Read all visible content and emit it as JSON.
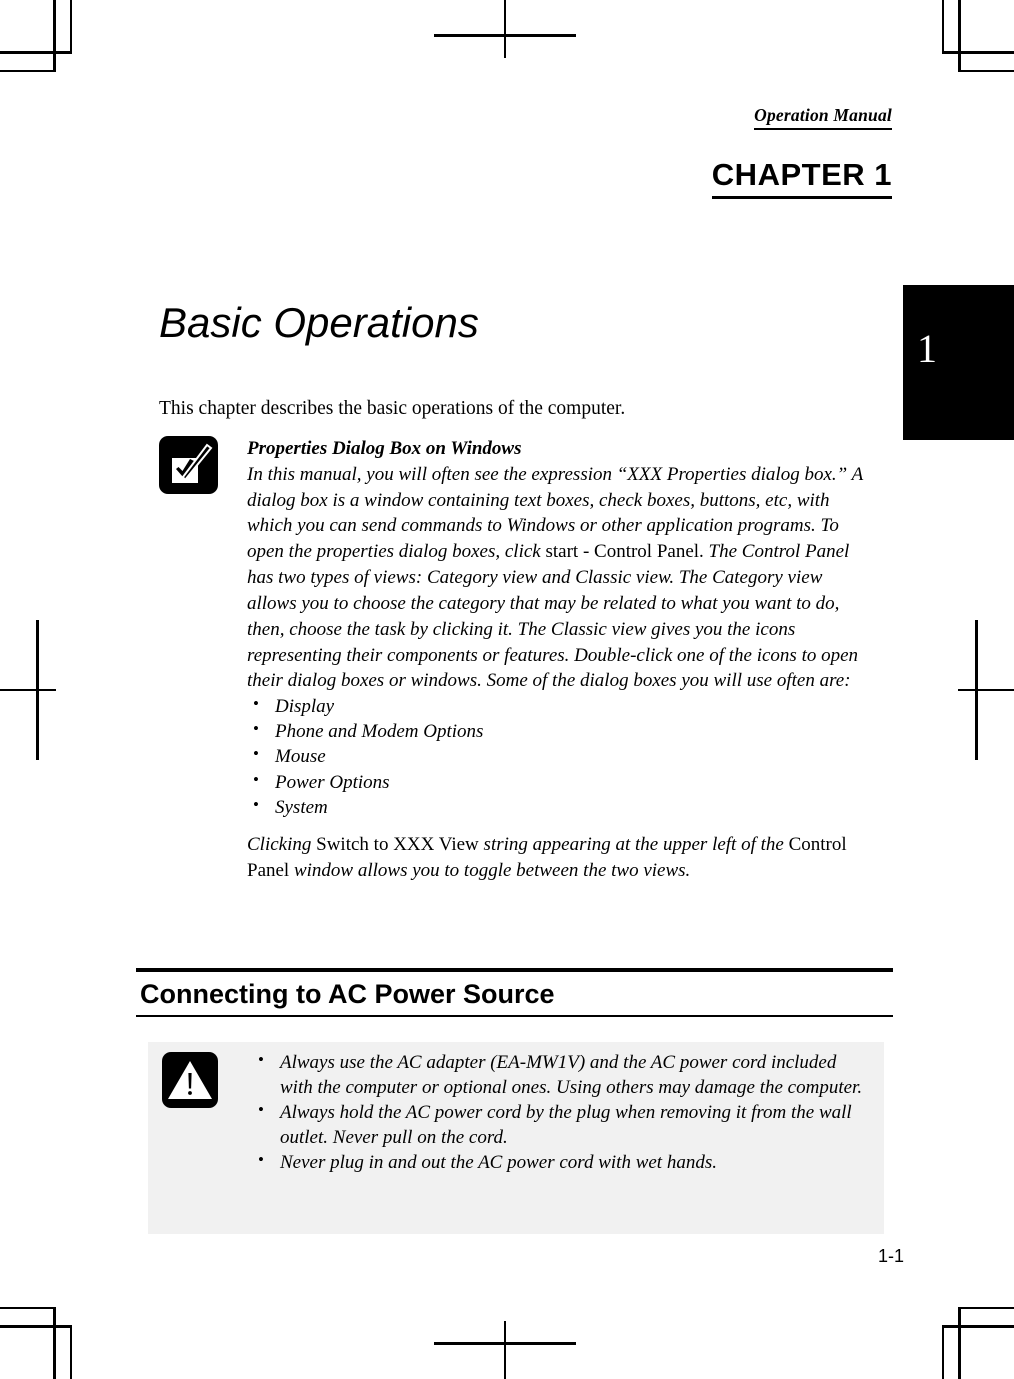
{
  "header": {
    "running_head": "Operation Manual",
    "chapter_label": "CHAPTER 1",
    "chapter_tab_number": "1"
  },
  "title": "Basic Operations",
  "intro_paragraph": "This chapter describes the basic operations of the computer.",
  "note": {
    "icon": "checkmark-note-icon",
    "heading": "Properties Dialog Box on Windows",
    "paragraph_part1": "In this manual, you will often see the expression “XXX Properties dialog box.” A dialog box is a window containing text boxes, check boxes, buttons, etc, with which you can send commands to Windows or other application programs. To open the properties dialog boxes, click ",
    "paragraph_roman1": "start - Control Panel.",
    "paragraph_part2": " The Control Panel has two types of views: Category view and Classic view. The Category view allows you to choose the category that may be related to what you want to do, then, choose the task by clicking it.  The Classic view gives you the icons representing their components or features. Double-click one of the icons to open their dialog boxes or windows.  Some of the dialog boxes you will use often are:",
    "list": [
      "Display",
      "Phone and Modem Options",
      "Mouse",
      "Power Options",
      "System"
    ],
    "closing_italic1": "Clicking ",
    "closing_roman1": "Switch to XXX View",
    "closing_italic2": " string appearing at the upper left of the ",
    "closing_roman2": "Control Panel",
    "closing_italic3": " window allows you to toggle between the two views."
  },
  "section": {
    "heading": "Connecting to AC Power Source"
  },
  "warning": {
    "icon": "warning-triangle-icon",
    "background_color": "#f1f1f1",
    "items": [
      "Always use the AC adapter (EA-MW1V) and the AC power cord included with the computer or optional ones.  Using others may damage the computer.",
      "Always hold the AC power cord by the plug when removing it from the wall outlet. Never pull on the cord.",
      "Never plug in and out the AC power cord with wet hands."
    ]
  },
  "footer": {
    "page_number": "1-1"
  }
}
